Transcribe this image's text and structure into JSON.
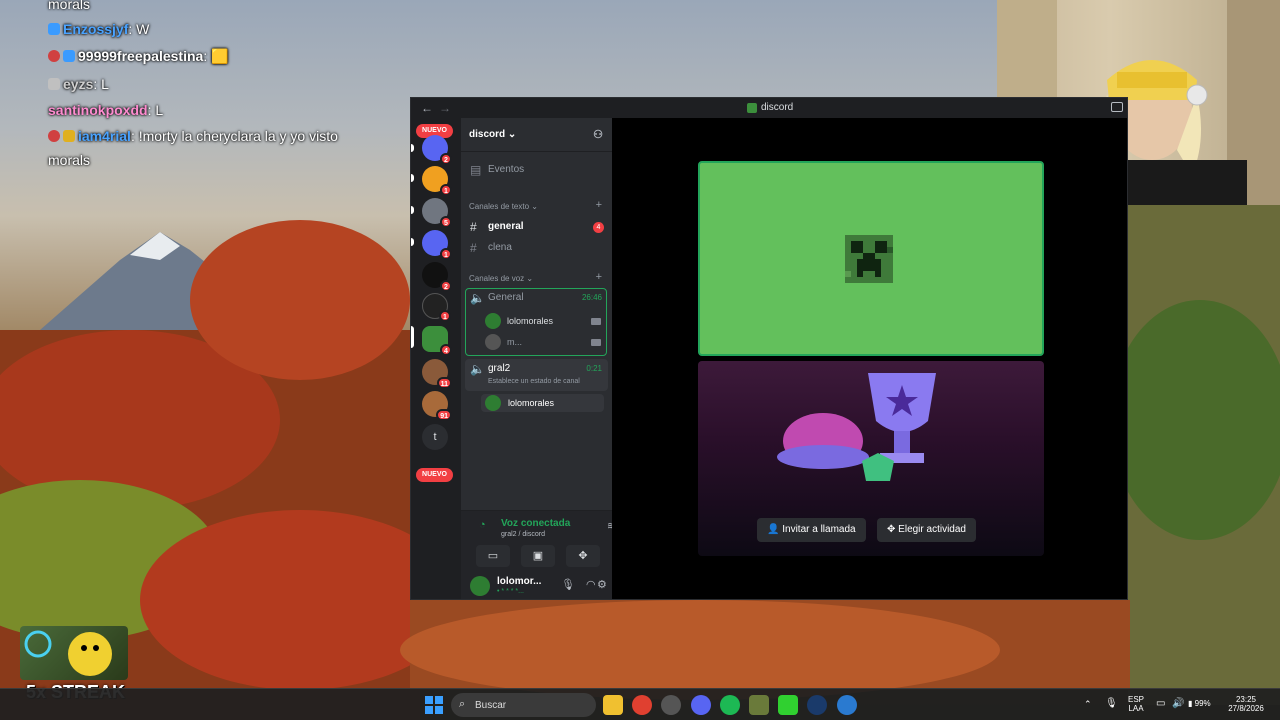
{
  "chat": [
    {
      "user": "",
      "message": "morals",
      "user_color": "#ffffff"
    },
    {
      "user": "Enzossjyf",
      "message": ": W",
      "user_color": "#4aa3ff"
    },
    {
      "user": "99999freepalestina",
      "message": ": 🟨",
      "user_color": "#ffffff"
    },
    {
      "user": "eyzs",
      "message": ": L",
      "user_color": "#d0d0d0"
    },
    {
      "user": "santinokpoxdd",
      "message": ": L",
      "user_color": "#ff8cd0"
    },
    {
      "user": "iam4rial",
      "message": ": !morty la cheryclara la y yo visto",
      "user_color": "#4aa3ff"
    },
    {
      "user": "",
      "message": "morals",
      "user_color": "#ffffff"
    }
  ],
  "overlay": {
    "streak": "5x STREAK"
  },
  "window": {
    "title": "discord",
    "nav_back": "←",
    "nav_forward": "→"
  },
  "servers": {
    "nuevo_top": "NUEVO",
    "nuevo_bottom": "NUEVO",
    "badges": [
      "2",
      "1",
      "5",
      "1",
      "2",
      "1",
      "4",
      "11",
      "91"
    ],
    "letter_server": "t"
  },
  "guild": {
    "name": "discord ⌄",
    "events": "Eventos",
    "text_category": "Canales de texto ⌄",
    "text_channels": [
      {
        "name": "general",
        "badge": "4"
      },
      {
        "name": "clena",
        "badge": ""
      }
    ],
    "voice_category": "Canales de voz ⌄",
    "voice_channels": [
      {
        "name": "General",
        "timer": "26:46",
        "users": [
          "lolomorales",
          "m..."
        ]
      },
      {
        "name": "gral2",
        "timer": "0:21",
        "status_hint": "Establece un estado de canal",
        "users": [
          "lolomorales"
        ]
      }
    ]
  },
  "voice_panel": {
    "status": "Voz conectada",
    "location": "gral2 / discord"
  },
  "user_panel": {
    "name": "lolomor...",
    "sub": "• * * * *..."
  },
  "stage": {
    "invite_label": "Invitar a llamada",
    "activity_label": "Elegir actividad"
  },
  "taskbar": {
    "search_placeholder": "Buscar",
    "lang_top": "ESP",
    "lang_bottom": "LAA",
    "battery": "99%",
    "time": "23:25",
    "date": "27/8/2026"
  },
  "colors": {
    "accent_green": "#23a55a",
    "danger_red": "#f23f43",
    "blurple": "#5865f2"
  }
}
